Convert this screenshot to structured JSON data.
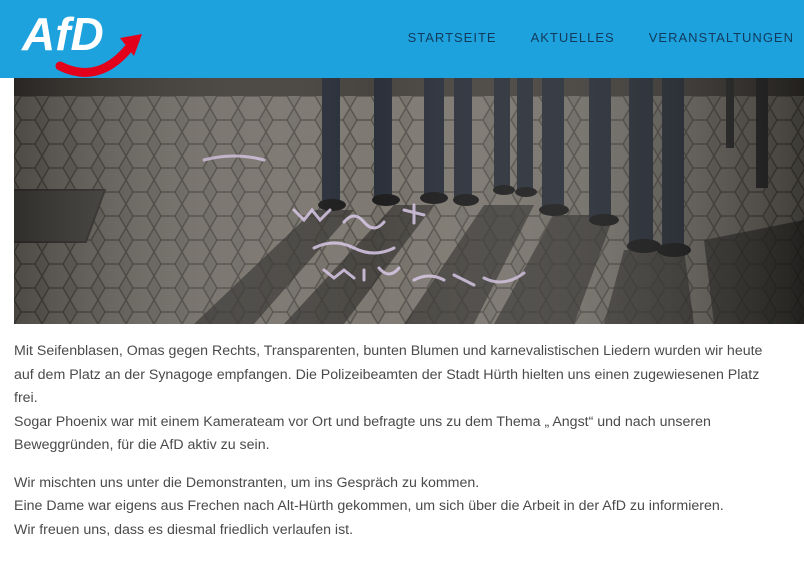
{
  "brand": {
    "logo_text": "AfD",
    "header_color": "#1ea2de",
    "arrow_color": "#e3001b"
  },
  "nav": {
    "items": [
      {
        "label": "STARTSEITE"
      },
      {
        "label": "AKTUELLES"
      },
      {
        "label": "VERANSTALTUNGEN"
      }
    ]
  },
  "photo": {
    "description_icon": "demonstration-photo"
  },
  "article": {
    "paragraph1": {
      "line1": "Mit Seifenblasen, Omas gegen Rechts, Transparenten, bunten Blumen und karnevalistischen Liedern wurden wir heute",
      "line2": "auf dem Platz an der Synagoge empfangen. Die Polizeibeamten der Stadt Hürth hielten uns einen zugewiesenen Platz",
      "line3": "frei.",
      "line4": "Sogar Phoenix war mit einem Kamerateam vor Ort und befragte uns zu dem Thema „ Angst“ und nach unseren",
      "line5": "Beweggründen, für die AfD aktiv zu sein."
    },
    "paragraph2": {
      "line1": "Wir mischten uns unter die Demonstranten, um ins Gespräch zu kommen.",
      "line2": "Eine Dame war eigens aus Frechen nach Alt-Hürth gekommen, um sich über die Arbeit in der AfD zu informieren.",
      "line3": "Wir freuen uns, dass es diesmal friedlich verlaufen ist."
    }
  }
}
